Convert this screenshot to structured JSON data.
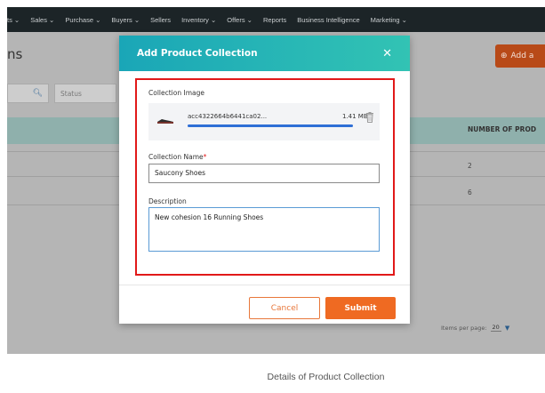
{
  "nav": {
    "items": [
      "ts ⌄",
      "Sales ⌄",
      "Purchase ⌄",
      "Buyers ⌄",
      "Sellers",
      "Inventory ⌄",
      "Offers ⌄",
      "Reports",
      "Business Intelligence",
      "Marketing ⌄"
    ]
  },
  "page": {
    "title": "ns",
    "add_button": "Add a",
    "status_placeholder": "Status",
    "column_header": "NUMBER OF PROD",
    "rows": [
      "2",
      "6"
    ],
    "items_per_page_label": "Items per page:",
    "items_per_page_value": "20"
  },
  "modal": {
    "title": "Add Product Collection",
    "close_icon": "close-icon",
    "collection_image_label": "Collection Image",
    "file_name": "acc4322664b6441ca02...",
    "file_size": "1.41 MB",
    "upload_progress": 1.0,
    "collection_name_label": "Collection Name",
    "required_mark": "*",
    "collection_name_value": "Saucony Shoes",
    "description_label": "Description",
    "description_value": "New cohesion 16 Running Shoes",
    "cancel_label": "Cancel",
    "submit_label": "Submit"
  },
  "caption": "Details of Product Collection",
  "colors": {
    "header_gradient_start": "#1aa6b7",
    "header_gradient_end": "#32c3b4",
    "accent_orange": "#ef6a22",
    "highlight_red": "#e11919",
    "progress_blue": "#2f6fd6"
  }
}
